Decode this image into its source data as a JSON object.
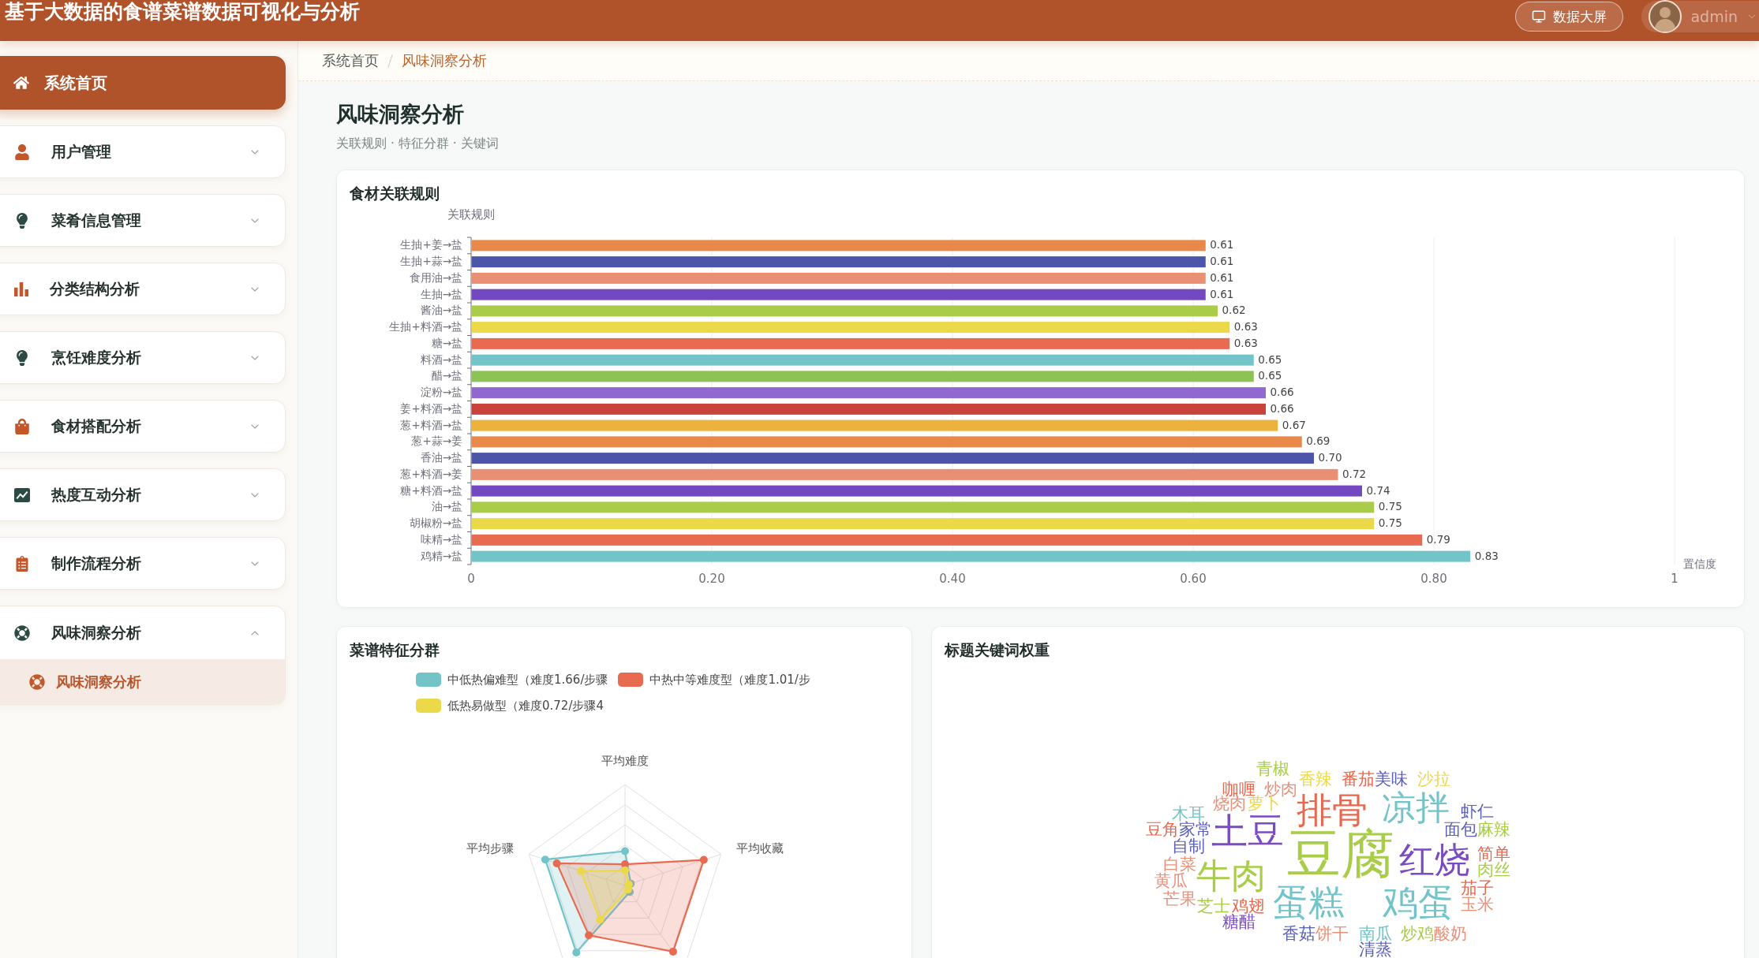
{
  "header": {
    "title": "基于大数据的食谱菜谱数据可视化与分析",
    "screen_button": "数据大屏",
    "user": "admin"
  },
  "sidebar": {
    "items": [
      {
        "kind": "link",
        "label": "系统首页",
        "selected": true
      },
      {
        "kind": "group",
        "label": "用户管理",
        "selected": false,
        "expanded": false
      },
      {
        "kind": "group",
        "label": "菜肴信息管理",
        "selected": false,
        "expanded": false
      },
      {
        "kind": "group",
        "label": "分类结构分析",
        "selected": false,
        "expanded": false
      },
      {
        "kind": "group",
        "label": "烹饪难度分析",
        "selected": false,
        "expanded": false
      },
      {
        "kind": "group",
        "label": "食材搭配分析",
        "selected": false,
        "expanded": false
      },
      {
        "kind": "group",
        "label": "热度互动分析",
        "selected": false,
        "expanded": false
      },
      {
        "kind": "group",
        "label": "制作流程分析",
        "selected": false,
        "expanded": false
      },
      {
        "kind": "group",
        "label": "风味洞察分析",
        "selected": false,
        "expanded": true,
        "children": [
          {
            "label": "风味洞察分析",
            "selected": true
          }
        ]
      }
    ]
  },
  "breadcrumb": [
    {
      "label": "系统首页",
      "current": false
    },
    {
      "label": "风味洞察分析",
      "current": true
    }
  ],
  "page": {
    "title": "风味洞察分析",
    "subtitle": "关联规则 · 特征分群 · 关键词"
  },
  "rules_card": {
    "title": "食材关联规则",
    "chart_data": {
      "type": "bar",
      "orientation": "horizontal",
      "ylabel": "关联规则",
      "xlabel": "置信度",
      "categories": [
        "生抽+姜→盐",
        "生抽+蒜→盐",
        "食用油→盐",
        "生抽→盐",
        "酱油→盐",
        "生抽+料酒→盐",
        "糖→盐",
        "料酒→盐",
        "醋→盐",
        "淀粉→盐",
        "姜+料酒→盐",
        "葱+料酒→盐",
        "葱+蒜→姜",
        "香油→盐",
        "葱+料酒→姜",
        "糖+料酒→盐",
        "油→盐",
        "胡椒粉→盐",
        "味精→盐",
        "鸡精→盐"
      ],
      "values": [
        0.61,
        0.61,
        0.61,
        0.61,
        0.62,
        0.63,
        0.63,
        0.65,
        0.65,
        0.66,
        0.66,
        0.67,
        0.69,
        0.7,
        0.72,
        0.74,
        0.75,
        0.75,
        0.79,
        0.83
      ],
      "value_labels": [
        "0.61",
        "0.61",
        "0.61",
        "0.61",
        "0.62",
        "0.63",
        "0.63",
        "0.65",
        "0.65",
        "0.66",
        "0.66",
        "0.67",
        "0.69",
        "0.70",
        "0.72",
        "0.74",
        "0.75",
        "0.75",
        "0.79",
        "0.83"
      ],
      "xlim": [
        0,
        1
      ],
      "xticks": [
        0,
        {
          "value": 0.2,
          "label": "0.20"
        },
        {
          "value": 0.4,
          "label": "0.40"
        },
        {
          "value": 0.6,
          "label": "0.60"
        },
        {
          "value": 0.8,
          "label": "0.80"
        },
        1
      ],
      "grid": true
    }
  },
  "cluster_card": {
    "title": "菜谱特征分群",
    "legend": [
      {
        "label": "中低热偏难型（难度1.66/步骤",
        "color": "#72c4c8"
      },
      {
        "label": "中热中等难度型（难度1.01/步",
        "color": "#e86a51"
      },
      {
        "label": "低热易做型（难度0.72/步骤4",
        "color": "#ecd94a"
      }
    ],
    "axes": [
      "平均难度",
      "平均步骤",
      "平均收藏"
    ]
  },
  "keywords_card": {
    "title": "标题关键词权重",
    "words": [
      {
        "text": "青椒",
        "color": "#a9cd48"
      },
      {
        "text": "香辣",
        "color": "#ecd94a"
      },
      {
        "text": "番茄",
        "color": "#e8674f"
      },
      {
        "text": "美味",
        "color": "#5b5fb5"
      },
      {
        "text": "沙拉",
        "color": "#ecd94a"
      },
      {
        "text": "咖喱",
        "color": "#e8674f"
      },
      {
        "text": "炒肉",
        "color": "#e8917a"
      },
      {
        "text": "烧肉",
        "color": "#e8917a"
      },
      {
        "text": "萝卜",
        "color": "#ecd94a"
      },
      {
        "text": "木耳",
        "color": "#72c4c8"
      },
      {
        "text": "排骨",
        "color": "#e8674f"
      },
      {
        "text": "凉拌",
        "color": "#72c4c8"
      },
      {
        "text": "虾仁",
        "color": "#5b5fb5"
      },
      {
        "text": "豆角",
        "color": "#e8674f"
      },
      {
        "text": "家常",
        "color": "#5b5fb5"
      },
      {
        "text": "土豆",
        "color": "#7b4bc2"
      },
      {
        "text": "豆腐",
        "color": "#a9cd48"
      },
      {
        "text": "面包",
        "color": "#5b5fb5"
      },
      {
        "text": "麻辣",
        "color": "#a9cd48"
      },
      {
        "text": "自制",
        "color": "#5b5fb5"
      },
      {
        "text": "红烧",
        "color": "#7b4bc2"
      },
      {
        "text": "简单",
        "color": "#e8674f"
      },
      {
        "text": "白菜",
        "color": "#e8917a"
      },
      {
        "text": "牛肉",
        "color": "#a9cd48"
      },
      {
        "text": "肉丝",
        "color": "#a9cd48"
      },
      {
        "text": "黄瓜",
        "color": "#e8917a"
      },
      {
        "text": "茄子",
        "color": "#e8674f"
      },
      {
        "text": "芒果",
        "color": "#e8917a"
      },
      {
        "text": "芝士",
        "color": "#a9cd48"
      },
      {
        "text": "鸡翅",
        "color": "#e8674f"
      },
      {
        "text": "蛋糕",
        "color": "#72c4c8"
      },
      {
        "text": "鸡蛋",
        "color": "#72c4c8"
      },
      {
        "text": "玉米",
        "color": "#e8917a"
      },
      {
        "text": "糖醋",
        "color": "#7b4bc2"
      },
      {
        "text": "香菇",
        "color": "#5b5fb5"
      },
      {
        "text": "饼干",
        "color": "#e8917a"
      },
      {
        "text": "南瓜",
        "color": "#72c4c8"
      },
      {
        "text": "炒鸡",
        "color": "#a9cd48"
      },
      {
        "text": "酸奶",
        "color": "#e8917a"
      },
      {
        "text": "清蒸",
        "color": "#5b5fb5"
      }
    ]
  }
}
